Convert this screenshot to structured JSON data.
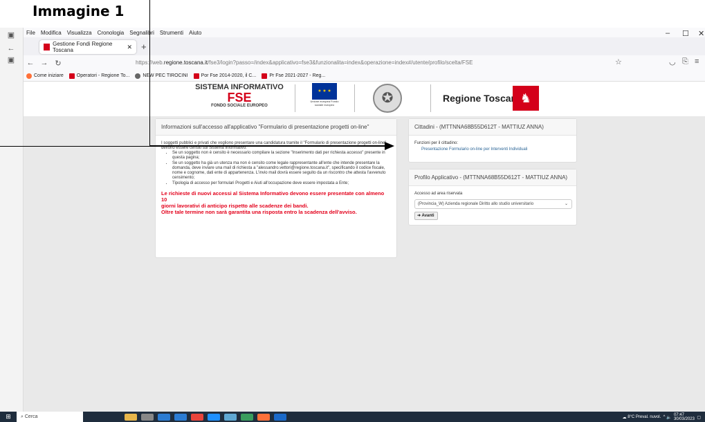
{
  "annotation": {
    "title": "Immagine 1"
  },
  "menu": [
    "File",
    "Modifica",
    "Visualizza",
    "Cronologia",
    "Segnalibri",
    "Strumenti",
    "Aiuto"
  ],
  "tab": {
    "title": "Gestione Fondi Regione Toscana"
  },
  "url": {
    "prefix": "https://web.",
    "domain": "regione.toscana.it",
    "path": "/fse3/login?passo=/index&applicativo=fse3&funzionalita=index&operazione=index#/utente/profilo/scelta/FSE"
  },
  "bookmarks": [
    "Come iniziare",
    "Operatori - Regione To...",
    "NEW PEC TIROCINI",
    "Por Fse 2014-2020, il C...",
    "Pr Fse 2021-2027 - Reg..."
  ],
  "header": {
    "fse_line1": "SISTEMA INFORMATIVO",
    "fse_line2": "FSE",
    "fse_line3": "FONDO SOCIALE EUROPEO",
    "eu_text": "Unione europea Fondo sociale europeo",
    "region": "Regione Toscana"
  },
  "info_panel": {
    "title": "Informazioni sull'accesso all'applicativo \"Formulario di presentazione progetti on-line\"",
    "intro": "I soggetti pubblici e privati che vogliono presentare una candidatura tramite il \"Formulario di presentazione progetti on-line\" devono essere censiti sul Sistema Informativo:",
    "bullets": [
      "Se un soggetto non è censito è necessario compilare la sezione \"Inserimento dati per richiesta accesso\" presente in questa pagina;",
      "Se un soggetto ha già un utenza ma non è censito come legale rappresentante all'ente che intende presentare la domanda, deve inviare una mail di richiesta a \"alessandro.vettori@regione.toscana.it\", specificando il codice fiscale, nome e cognome, dati ente di appartenenza. L'invio mail dovrà essere seguito da un riscontro che attesta l'avvenuto censimento;",
      "Tipologia di accesso per formulari Progetti e Aiuti all'occupazione deve essere impostata a Ente;"
    ],
    "warning_line1": "Le richieste di nuovi accessi al Sistema Informativo devono essere presentate con almeno 10",
    "warning_line2": "giorni lavorativi di anticipo rispetto alle scadenze dei bandi.",
    "warning_line3": "Oltre tale termine non sarà garantita una risposta entro la scadenza dell'avviso."
  },
  "citizen_panel": {
    "title": "Cittadini - (MTTNNA68B55D612T - MATTIUZ ANNA)",
    "label": "Funzioni per il cittadino:",
    "link": "Presentazione Formulario on-line per Interventi Individuali"
  },
  "profile_panel": {
    "title": "Profilo Applicativo - (MTTNNA68B55D612T - MATTIUZ ANNA)",
    "label": "Accesso ad area riservata",
    "select_value": "(Provincia_W) Azienda regionale Diritto allo studio universitario",
    "button": "Avanti"
  },
  "taskbar": {
    "search": "Cerca",
    "weather": "8°C Preval. nuvol.",
    "time": "07:47",
    "date": "30/03/2023"
  }
}
